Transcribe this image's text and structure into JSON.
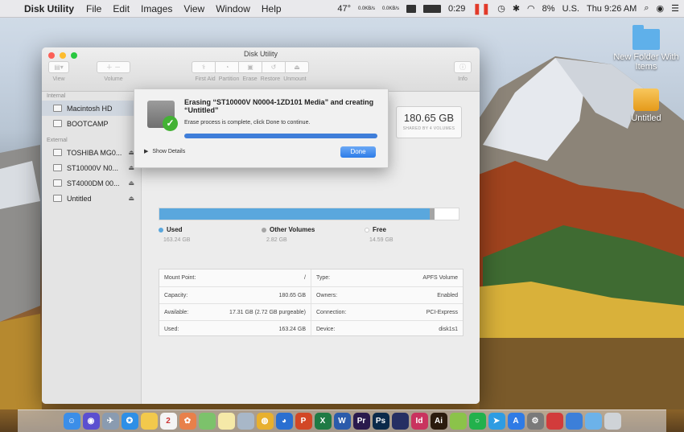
{
  "menubar": {
    "app_name": "Disk Utility",
    "menus": [
      "File",
      "Edit",
      "Images",
      "View",
      "Window",
      "Help"
    ],
    "temp": "47°",
    "net_up": "0.0KB/s",
    "net_down": "0.0KB/s",
    "battery_time": "0:29",
    "battery_pct": "8%",
    "input_source": "U.S.",
    "clock": "Thu 9:26 AM"
  },
  "desktop": {
    "icons": [
      {
        "label": "New Folder With Items"
      },
      {
        "label": "Untitled"
      }
    ]
  },
  "window": {
    "title": "Disk Utility",
    "toolbar": {
      "view_label": "View",
      "volume_label": "Volume",
      "first_aid_label": "First Aid",
      "partition_label": "Partition",
      "erase_label": "Erase",
      "restore_label": "Restore",
      "unmount_label": "Unmount",
      "info_label": "Info"
    },
    "sidebar": {
      "internal_label": "Internal",
      "external_label": "External",
      "internal_items": [
        {
          "label": "Macintosh HD"
        },
        {
          "label": "BOOTCAMP"
        }
      ],
      "external_items": [
        {
          "label": "TOSHIBA MG0..."
        },
        {
          "label": "ST10000V N0..."
        },
        {
          "label": "ST4000DM 00..."
        },
        {
          "label": "Untitled"
        }
      ]
    },
    "capacity": {
      "value": "180.65 GB",
      "caption": "SHARED BY 4 VOLUMES"
    },
    "usage": {
      "used_fraction": 0.904,
      "other_fraction": 0.016,
      "legend": [
        {
          "label": "Used",
          "value": "163.24 GB",
          "color": "#5aa7dd"
        },
        {
          "label": "Other Volumes",
          "value": "2.82 GB",
          "color": "#a5a5a5"
        },
        {
          "label": "Free",
          "value": "14.59 GB",
          "color": "#ffffff"
        }
      ]
    },
    "info_rows": [
      {
        "k1": "Mount Point:",
        "v1": "/",
        "k2": "Type:",
        "v2": "APFS Volume"
      },
      {
        "k1": "Capacity:",
        "v1": "180.65 GB",
        "k2": "Owners:",
        "v2": "Enabled"
      },
      {
        "k1": "Available:",
        "v1": "17.31 GB (2.72 GB purgeable)",
        "k2": "Connection:",
        "v2": "PCI-Express"
      },
      {
        "k1": "Used:",
        "v1": "163.24 GB",
        "k2": "Device:",
        "v2": "disk1s1"
      }
    ]
  },
  "sheet": {
    "title": "Erasing “ST10000V N0004-1ZD101 Media” and creating “Untitled”",
    "subtitle": "Erase process is complete, click Done to continue.",
    "progress": 1.0,
    "show_details": "Show Details",
    "done_label": "Done"
  },
  "dock": {
    "apps": [
      {
        "name": "finder",
        "glyph": "☺",
        "color": "#3b8ee8"
      },
      {
        "name": "siri",
        "glyph": "◉",
        "color": "#5b4fd0"
      },
      {
        "name": "launchpad",
        "glyph": "✈",
        "color": "#8a9bb0"
      },
      {
        "name": "safari",
        "glyph": "✪",
        "color": "#2e8fe6"
      },
      {
        "name": "notes-yellow",
        "glyph": "",
        "color": "#f2c94c"
      },
      {
        "name": "calendar",
        "glyph": "2",
        "color": "#f4f4f4"
      },
      {
        "name": "photos",
        "glyph": "✿",
        "color": "#e8804a"
      },
      {
        "name": "maps",
        "glyph": "",
        "color": "#7cc26b"
      },
      {
        "name": "notes",
        "glyph": "",
        "color": "#f5e9a8"
      },
      {
        "name": "preview",
        "glyph": "",
        "color": "#a8b7c8"
      },
      {
        "name": "chrome",
        "glyph": "◍",
        "color": "#e8b02e"
      },
      {
        "name": "network",
        "glyph": "◕",
        "color": "#2a6fd1"
      },
      {
        "name": "powerpoint",
        "glyph": "P",
        "color": "#d24726"
      },
      {
        "name": "excel",
        "glyph": "X",
        "color": "#1f7a45"
      },
      {
        "name": "word",
        "glyph": "W",
        "color": "#2b5bab"
      },
      {
        "name": "premiere",
        "glyph": "Pr",
        "color": "#2a1a4d"
      },
      {
        "name": "photoshop",
        "glyph": "Ps",
        "color": "#0b2a4a"
      },
      {
        "name": "bridge",
        "glyph": "",
        "color": "#262f63"
      },
      {
        "name": "indesign",
        "glyph": "Id",
        "color": "#c9335f"
      },
      {
        "name": "illustrator",
        "glyph": "Ai",
        "color": "#2b1b0e"
      },
      {
        "name": "android",
        "glyph": "",
        "color": "#8bc34a"
      },
      {
        "name": "line",
        "glyph": "○",
        "color": "#22b14c"
      },
      {
        "name": "telegram",
        "glyph": "➤",
        "color": "#2e9ce2"
      },
      {
        "name": "app-store",
        "glyph": "A",
        "color": "#2f7be5"
      },
      {
        "name": "settings",
        "glyph": "⚙",
        "color": "#7a7a7a"
      },
      {
        "name": "remote",
        "glyph": "",
        "color": "#d23b3b"
      },
      {
        "name": "qq",
        "glyph": "",
        "color": "#3c7fd9"
      },
      {
        "name": "folder",
        "glyph": "",
        "color": "#6cb2e9"
      },
      {
        "name": "trash",
        "glyph": "",
        "color": "#cfd3d7"
      }
    ]
  }
}
